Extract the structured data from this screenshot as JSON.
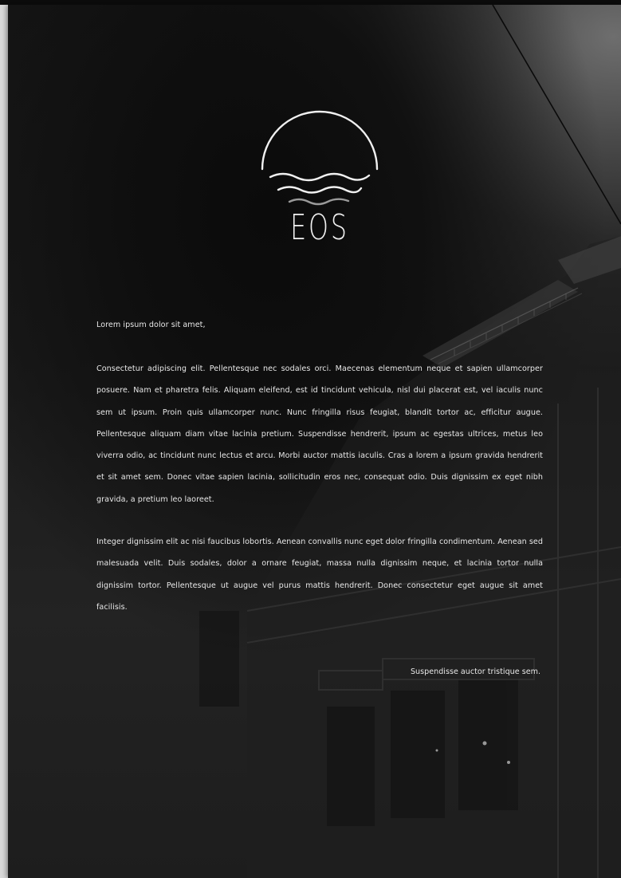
{
  "brand": {
    "name": "EOS",
    "logo_icon": "sun-over-waves-icon"
  },
  "letter": {
    "greeting": "Lorem ipsum dolor sit amet,",
    "paragraphs": [
      "Consectetur adipiscing elit. Pellentesque nec sodales orci. Maecenas elementum neque et sapien ullamcorper posuere. Nam et pharetra felis. Aliquam eleifend, est id tincidunt vehicula, nisl dui placerat est, vel iaculis nunc sem ut ipsum. Proin quis ullamcorper nunc. Nunc fringilla risus feugiat, blandit tortor ac, efficitur augue. Pellentesque aliquam diam vitae lacinia pretium. Suspendisse hendrerit, ipsum ac egestas ultrices, metus leo viverra odio, ac tincidunt nunc lectus et arcu. Morbi auctor mattis iaculis. Cras a lorem a ipsum gravida hendrerit et sit amet sem. Donec vitae sapien lacinia, sollicitudin eros nec, consequat odio. Duis dignissim ex eget nibh gravida, a pretium leo laoreet.",
      "Integer dignissim elit ac nisi faucibus lobortis. Aenean convallis nunc eget dolor fringilla condimentum. Aenean sed malesuada velit. Duis sodales, dolor a ornare feugiat, massa nulla dignissim neque, et lacinia tortor nulla dignissim tortor. Pellentesque ut augue vel purus mattis hendrerit. Donec consectetur eget augue sit amet facilisis."
    ],
    "signoff": "Suspendisse auctor tristique sem."
  },
  "colors": {
    "text": "#e8e8e8",
    "logo_line": "#f0f0f0",
    "logo_wave_muted": "#9a9a9a",
    "background_dark": "#151515"
  }
}
